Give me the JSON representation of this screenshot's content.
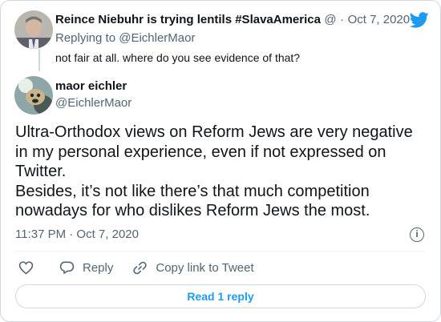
{
  "parent_tweet": {
    "author_name": "Reince Niebuhr is trying lentils #SlavaAmerica",
    "author_suffix": "@",
    "separator": "·",
    "date": "Oct 7, 2020",
    "replying_to": "Replying to @EichlerMaor",
    "text": "not fair at all.  where do you see evidence of that?"
  },
  "tweet": {
    "author_name": "maor eichler",
    "handle": "@EichlerMaor",
    "text_lines": [
      "Ultra-Orthodox views on Reform Jews are very negative",
      "in my personal experience, even if not expressed on",
      "Twitter.",
      "Besides, it’s not like there’s that much competition",
      "nowadays for who dislikes Reform Jews the most."
    ],
    "timestamp": "11:37 PM · Oct 7, 2020",
    "info_glyph": "i"
  },
  "actions": {
    "like_icon": "heart-icon",
    "reply_label": "Reply",
    "reply_icon": "speech-bubble-icon",
    "copy_label": "Copy link to Tweet",
    "copy_icon": "link-icon"
  },
  "read_replies_label": "Read 1 reply",
  "colors": {
    "accent": "#1d9bf0",
    "text": "#0f1419",
    "muted": "#536471",
    "border": "#cfd9de"
  }
}
